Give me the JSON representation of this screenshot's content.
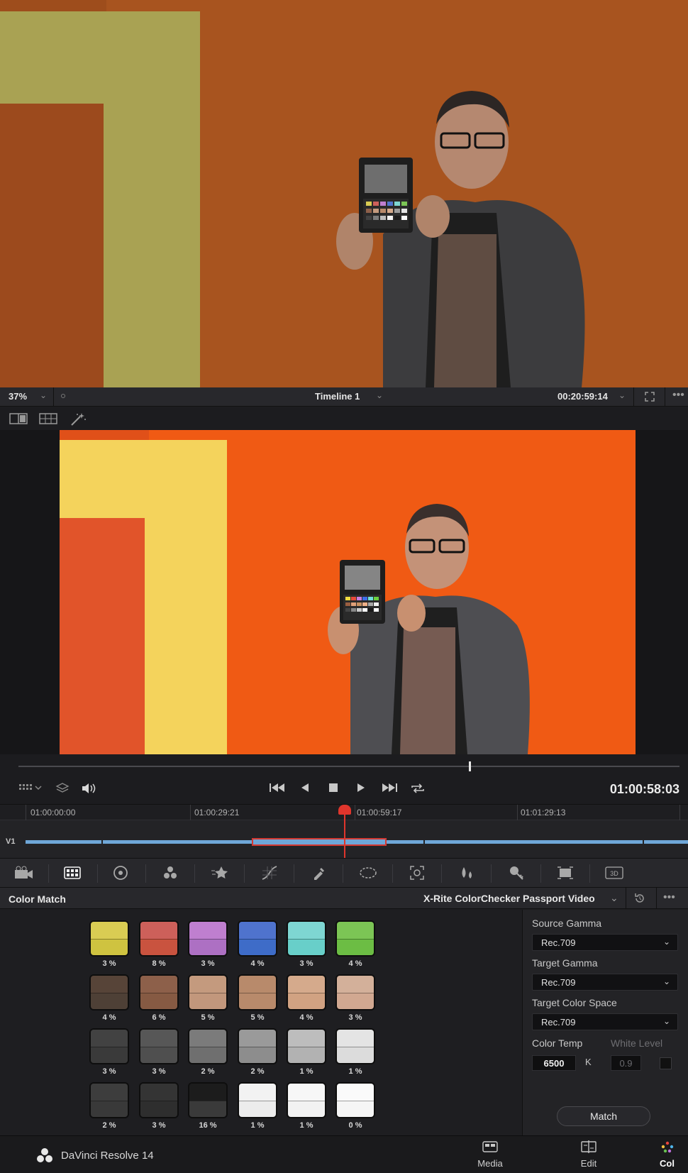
{
  "viewer": {
    "zoom": "37%",
    "timeline_name": "Timeline 1",
    "source_timecode": "00:20:59:14",
    "record_timecode": "01:00:58:03"
  },
  "timeline": {
    "track": "V1",
    "ruler": [
      "01:00:00:00",
      "01:00:29:21",
      "01:00:59:17",
      "01:01:29:13"
    ]
  },
  "color_match": {
    "title": "Color Match",
    "chart": "X-Rite ColorChecker Passport Video",
    "swatches": [
      {
        "top": "#d9cc53",
        "bottom": "#cfc340",
        "pct": "3 %"
      },
      {
        "top": "#cd605a",
        "bottom": "#c9533f",
        "pct": "8 %"
      },
      {
        "top": "#bf7fcf",
        "bottom": "#ad70c3",
        "pct": "3 %"
      },
      {
        "top": "#4f73cd",
        "bottom": "#3e6cc8",
        "pct": "4 %"
      },
      {
        "top": "#7ed6d2",
        "bottom": "#68cfc9",
        "pct": "3 %"
      },
      {
        "top": "#7cc555",
        "bottom": "#6cbd44",
        "pct": "4 %"
      },
      {
        "top": "#574438",
        "bottom": "#4e4036",
        "pct": "4 %"
      },
      {
        "top": "#8d604a",
        "bottom": "#865a43",
        "pct": "6 %"
      },
      {
        "top": "#c49a7e",
        "bottom": "#c2977c",
        "pct": "5 %"
      },
      {
        "top": "#b88a6b",
        "bottom": "#b88a6b",
        "pct": "5 %"
      },
      {
        "top": "#d5aa8c",
        "bottom": "#d1a282",
        "pct": "4 %"
      },
      {
        "top": "#d3b09a",
        "bottom": "#d1a891",
        "pct": "3 %"
      },
      {
        "top": "#424242",
        "bottom": "#3a3a3a",
        "pct": "3 %"
      },
      {
        "top": "#575757",
        "bottom": "#4f4f4f",
        "pct": "3 %"
      },
      {
        "top": "#7b7b7b",
        "bottom": "#6f6f6f",
        "pct": "2 %"
      },
      {
        "top": "#9a9a9a",
        "bottom": "#8d8d8d",
        "pct": "2 %"
      },
      {
        "top": "#bdbdbd",
        "bottom": "#b2b2b2",
        "pct": "1 %"
      },
      {
        "top": "#e4e4e4",
        "bottom": "#dcdcdc",
        "pct": "1 %"
      },
      {
        "top": "#3d3d3d",
        "bottom": "#393939",
        "pct": "2 %"
      },
      {
        "top": "#343434",
        "bottom": "#2e2e2e",
        "pct": "3 %"
      },
      {
        "top": "#1c1c1c",
        "bottom": "#3a3a3a",
        "pct": "16 %"
      },
      {
        "top": "#f2f2f2",
        "bottom": "#ececec",
        "pct": "1 %"
      },
      {
        "top": "#f7f7f7",
        "bottom": "#f2f2f2",
        "pct": "1 %"
      },
      {
        "top": "#fafafa",
        "bottom": "#f5f5f5",
        "pct": "0 %"
      }
    ],
    "source_gamma_label": "Source Gamma",
    "source_gamma": "Rec.709",
    "target_gamma_label": "Target Gamma",
    "target_gamma": "Rec.709",
    "target_space_label": "Target Color Space",
    "target_space": "Rec.709",
    "color_temp_label": "Color Temp",
    "white_level_label": "White Level",
    "color_temp": "6500",
    "temp_unit": "K",
    "white_level": "0.9",
    "match_label": "Match"
  },
  "page_bar": {
    "app_name": "DaVinci Resolve 14",
    "pages": [
      {
        "label": "Media"
      },
      {
        "label": "Edit"
      },
      {
        "label": "Col"
      }
    ]
  }
}
